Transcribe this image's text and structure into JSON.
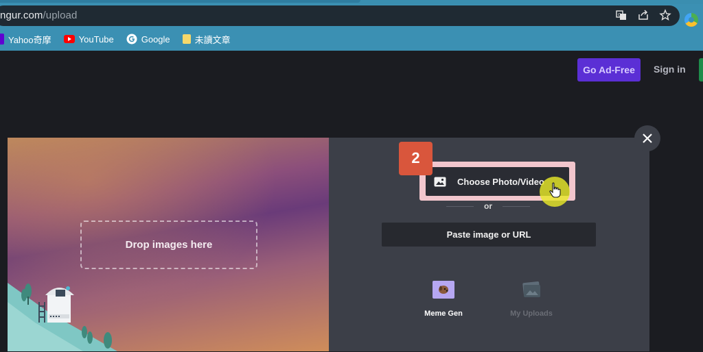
{
  "browser": {
    "url_domain": "ngur.com",
    "url_path": "/upload",
    "bookmarks": [
      {
        "label": "Yahoo奇摩",
        "icon": "yahoo-icon"
      },
      {
        "label": "YouTube",
        "icon": "youtube-icon"
      },
      {
        "label": "Google",
        "icon": "google-icon"
      },
      {
        "label": "未讀文章",
        "icon": "folder-icon"
      }
    ]
  },
  "header": {
    "go_adfree_label": "Go Ad-Free",
    "signin_label": "Sign in"
  },
  "upload_modal": {
    "drop_label": "Drop images here",
    "step_badge": "2",
    "choose_label": "Choose Photo/Video",
    "or_label": "or",
    "paste_label": "Paste image or URL",
    "tools": [
      {
        "label": "Meme Gen",
        "icon": "meme-gen-icon",
        "enabled": true
      },
      {
        "label": "My Uploads",
        "icon": "my-uploads-icon",
        "enabled": false
      }
    ]
  },
  "colors": {
    "chrome": "#3b90b3",
    "page_bg": "#1b1c21",
    "adfree": "#5b2fd5",
    "badge": "#d9563c",
    "highlight_frame": "#f2c6cd",
    "right_pane": "#3c3f48"
  }
}
